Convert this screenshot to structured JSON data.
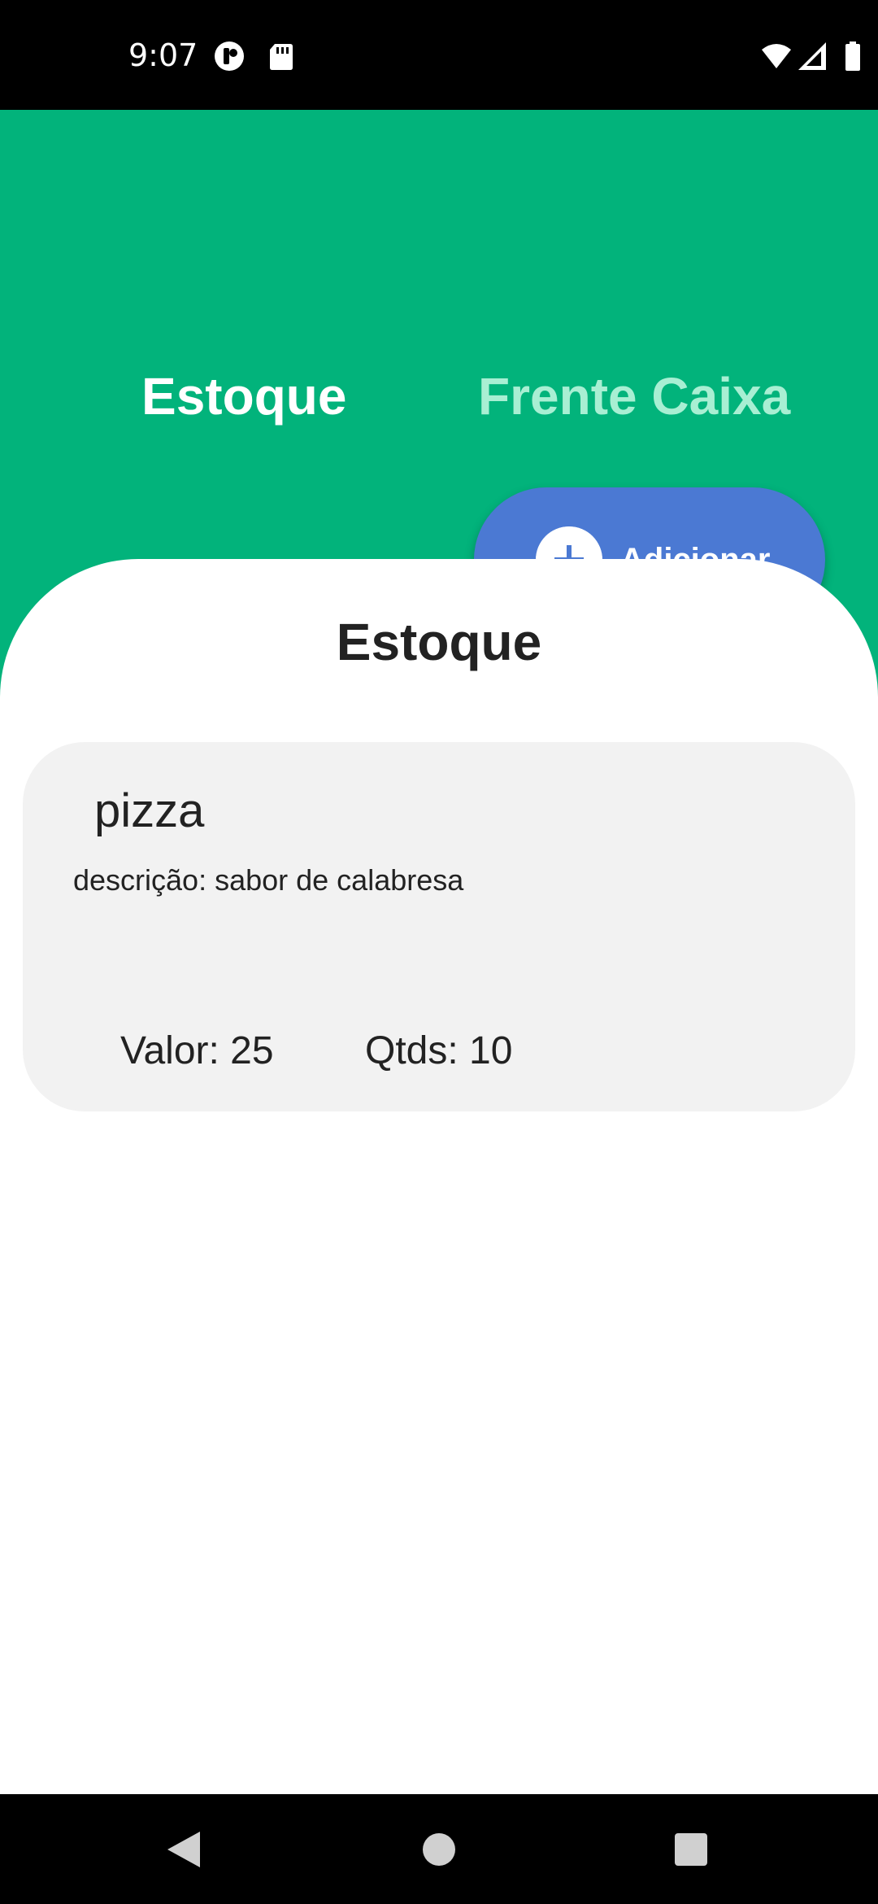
{
  "status_bar": {
    "time": "9:07",
    "icons": [
      "notification-app-icon",
      "sd-card-icon",
      "wifi-icon",
      "cell-signal-icon",
      "battery-icon"
    ]
  },
  "header": {
    "tabs": [
      {
        "label": "Estoque",
        "active": true
      },
      {
        "label": "Frente Caixa",
        "active": false
      }
    ],
    "add_button": {
      "label": "Adicionar",
      "icon": "plus-icon"
    }
  },
  "main": {
    "title": "Estoque",
    "items": [
      {
        "name": "pizza",
        "description": "descrição: sabor de calabresa",
        "value": "Valor: 25",
        "quantity": "Qtds: 10"
      }
    ]
  },
  "nav_bar": {
    "buttons": [
      "back-icon",
      "home-icon",
      "recents-icon"
    ]
  },
  "colors": {
    "header_green": "#02b37b",
    "button_blue": "#4b79d3",
    "inactive_tab": "#a8efd3",
    "card_bg": "#f2f2f2"
  }
}
